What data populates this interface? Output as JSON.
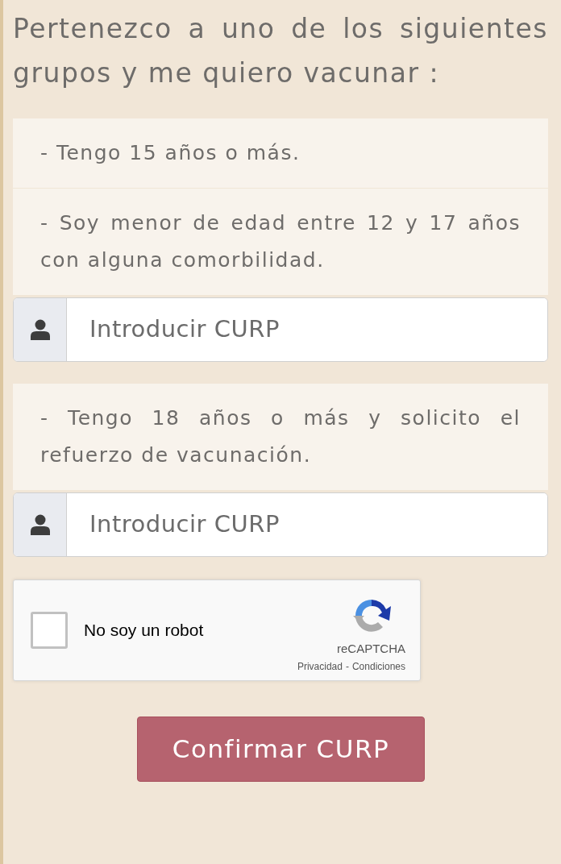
{
  "heading": "Pertenezco a uno de los siguientes grupos y me quiero vacunar :",
  "groups": [
    {
      "text": "- Tengo 15 años o más."
    },
    {
      "text": "- Soy menor de edad entre 12 y 17 años con alguna comorbilidad.",
      "input": {
        "placeholder": "Introducir CURP"
      }
    },
    {
      "text": "- Tengo 18 años o más y solicito el refuerzo de vacunación.",
      "input": {
        "placeholder": "Introducir CURP"
      }
    }
  ],
  "captcha": {
    "label": "No soy un robot",
    "checked": false,
    "brand": "reCAPTCHA",
    "privacy": "Privacidad",
    "separator": "-",
    "terms": "Condiciones"
  },
  "submit_button": "Confirmar CURP"
}
